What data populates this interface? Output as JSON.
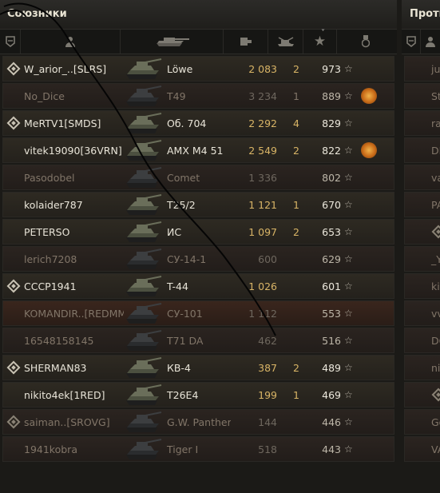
{
  "allies": {
    "title": "Союзники",
    "headers": {
      "squad_icon": "squad-icon",
      "player_icon": "player-icon",
      "tank_icon": "tank-icon",
      "damage_icon": "damage-icon",
      "kills_icon": "frags-icon",
      "sort_indicator": "˅",
      "xp_icon": "star-icon",
      "medal_icon": "medal-icon"
    },
    "rows": [
      {
        "clan": true,
        "name": "W_arior_..[SLRS]",
        "vehicle": "Löwe",
        "damage": "2 083",
        "kills": "2",
        "xp": "973",
        "medal": false,
        "alive": true
      },
      {
        "clan": false,
        "name": "No_Dice",
        "vehicle": "T49",
        "damage": "3 234",
        "kills": "1",
        "xp": "889",
        "medal": true,
        "alive": false
      },
      {
        "clan": true,
        "name": "MeRTV1[SMDS]",
        "vehicle": "Об. 704",
        "damage": "2 292",
        "kills": "4",
        "xp": "829",
        "medal": false,
        "alive": true
      },
      {
        "clan": false,
        "name": "vitek19090[36VRN]",
        "vehicle": "AMX M4 51",
        "damage": "2 549",
        "kills": "2",
        "xp": "822",
        "medal": true,
        "alive": true
      },
      {
        "clan": false,
        "name": "Pasodobel",
        "vehicle": "Comet",
        "damage": "1 336",
        "kills": "",
        "xp": "802",
        "medal": false,
        "alive": false
      },
      {
        "clan": false,
        "name": "kolaider787",
        "vehicle": "T25/2",
        "damage": "1 121",
        "kills": "1",
        "xp": "670",
        "medal": false,
        "alive": true
      },
      {
        "clan": false,
        "name": "PETERSO",
        "vehicle": "ИС",
        "damage": "1 097",
        "kills": "2",
        "xp": "653",
        "medal": false,
        "alive": true
      },
      {
        "clan": false,
        "name": "lerich7208",
        "vehicle": "СУ-14-1",
        "damage": "600",
        "kills": "",
        "xp": "629",
        "medal": false,
        "alive": false
      },
      {
        "clan": true,
        "name": "CCCP1941",
        "vehicle": "T-44",
        "damage": "1 026",
        "kills": "",
        "xp": "601",
        "medal": false,
        "alive": true
      },
      {
        "clan": false,
        "name": "KOMANDIR..[REDMM]",
        "vehicle": "СУ-101",
        "damage": "1 112",
        "kills": "",
        "xp": "553",
        "medal": false,
        "alive": false,
        "highlight": true
      },
      {
        "clan": false,
        "name": "16548158145",
        "vehicle": "T71 DA",
        "damage": "462",
        "kills": "",
        "xp": "516",
        "medal": false,
        "alive": false
      },
      {
        "clan": true,
        "name": "SHERMAN83",
        "vehicle": "КВ-4",
        "damage": "387",
        "kills": "2",
        "xp": "489",
        "medal": false,
        "alive": true
      },
      {
        "clan": false,
        "name": "nikito4ek[1RED]",
        "vehicle": "T26E4",
        "damage": "199",
        "kills": "1",
        "xp": "469",
        "medal": false,
        "alive": true
      },
      {
        "clan": true,
        "name": "saiman..[SROVG]",
        "vehicle": "G.W. Panther",
        "damage": "144",
        "kills": "",
        "xp": "446",
        "medal": false,
        "alive": false
      },
      {
        "clan": false,
        "name": "1941kobra",
        "vehicle": "Tiger I",
        "damage": "518",
        "kills": "",
        "xp": "443",
        "medal": false,
        "alive": false
      }
    ]
  },
  "enemies": {
    "title": "Проти",
    "rows": [
      {
        "name": "ju",
        "clan": false,
        "alive": false
      },
      {
        "name": "St",
        "clan": false,
        "alive": false
      },
      {
        "name": "rah",
        "clan": false,
        "alive": false
      },
      {
        "name": "DI",
        "clan": false,
        "alive": false
      },
      {
        "name": "va",
        "clan": false,
        "alive": false
      },
      {
        "name": "PA",
        "clan": false,
        "alive": false
      },
      {
        "name": "",
        "clan": true,
        "alive": false
      },
      {
        "name": "_Y",
        "clan": false,
        "alive": false
      },
      {
        "name": "kir",
        "clan": false,
        "alive": false
      },
      {
        "name": "vv",
        "clan": false,
        "alive": false
      },
      {
        "name": "DG",
        "clan": false,
        "alive": false
      },
      {
        "name": "nik",
        "clan": false,
        "alive": false
      },
      {
        "name": "",
        "clan": true,
        "alive": false
      },
      {
        "name": "Go",
        "clan": false,
        "alive": false
      },
      {
        "name": "VA",
        "clan": false,
        "alive": false
      }
    ]
  },
  "colors": {
    "background": "#1b1a17",
    "damage_alive": "#d8b466",
    "damage_dead": "#6e675e",
    "medal": "#e09a3c"
  }
}
